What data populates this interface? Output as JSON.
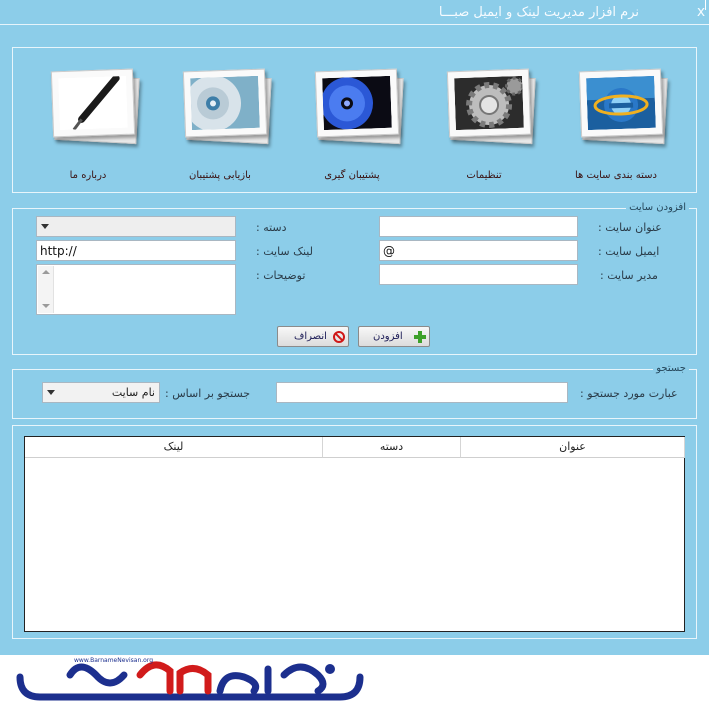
{
  "window": {
    "title": "نرم افزار مدیریت لینک و ایمیل صبـــا",
    "close_label": "x"
  },
  "toolbar": {
    "items": [
      {
        "label": "دسته بندی سایت ها",
        "icon": "browser-icon"
      },
      {
        "label": "تنظیمات",
        "icon": "settings-gear-icon"
      },
      {
        "label": "پشتیبان گیری",
        "icon": "backup-disc-icon"
      },
      {
        "label": "بازیابی پشتیبان",
        "icon": "restore-disc-icon"
      },
      {
        "label": "درباره ما",
        "icon": "pen-icon"
      }
    ]
  },
  "add_site": {
    "legend": "افزودن سایت",
    "site_title_label": "عنوان سایت :",
    "site_title_value": "",
    "email_label": "ایمیل سایت :",
    "email_value": "@",
    "admin_label": "مدیر سایت :",
    "admin_value": "",
    "category_label": "دسته :",
    "category_value": "",
    "link_label": "لینک سایت :",
    "link_value": "http://",
    "description_label": "توضیحات :",
    "description_value": "",
    "add_button": "افزودن",
    "cancel_button": "انصراف"
  },
  "search": {
    "legend": "جستجو",
    "query_label": "عبارت مورد جستجو :",
    "query_value": "",
    "by_label": "جستجو بر اساس :",
    "by_value": "نام سایت"
  },
  "table": {
    "columns": [
      "عنوان",
      "دسته",
      "لینک"
    ],
    "rows": []
  },
  "footer": {
    "logo_text": "برنامه نویسان",
    "logo_url": "www.BarnameNevisan.org"
  },
  "colors": {
    "window_bg": "#8ccde9",
    "logo_blue": "#1c2f8e",
    "logo_red": "#d11b1b"
  }
}
